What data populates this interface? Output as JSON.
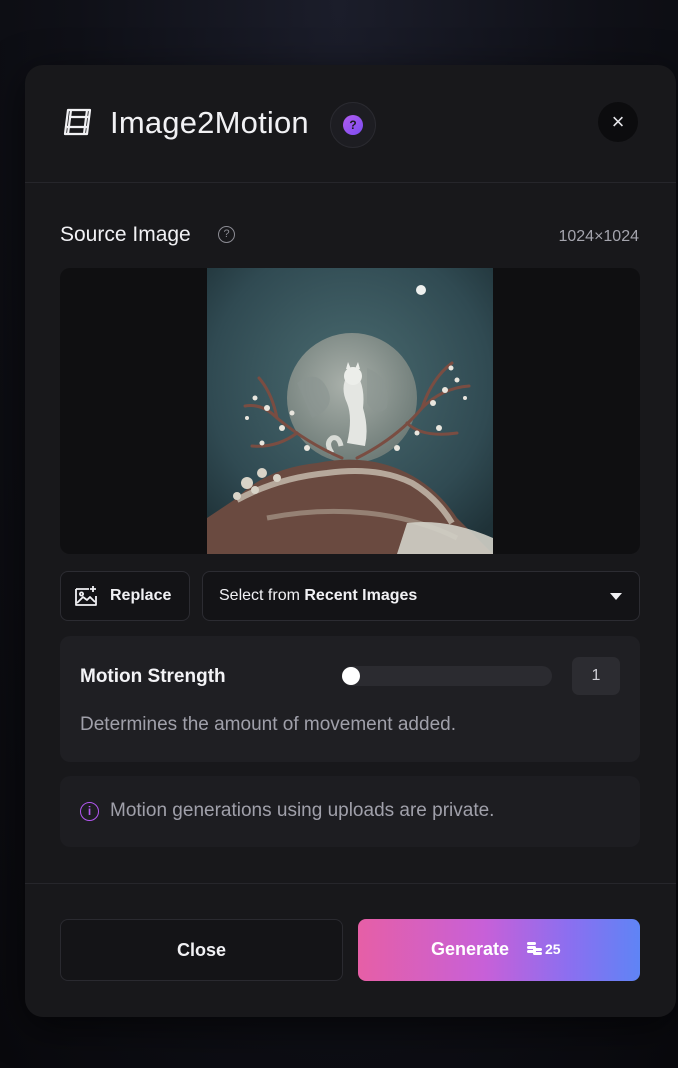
{
  "dialog": {
    "title": "Image2Motion",
    "help_badge_text": "?",
    "close_icon": "×"
  },
  "source": {
    "label": "Source Image",
    "help_icon_text": "?",
    "dimensions": "1024×1024"
  },
  "replace_button": {
    "label": "Replace",
    "icon": "image-sparkle-icon"
  },
  "recent_select": {
    "prefix": "Select from ",
    "value": "Recent Images"
  },
  "motion_strength": {
    "label": "Motion Strength",
    "value": "1",
    "level_fraction": 0.0,
    "description": "Determines the amount of movement added."
  },
  "notice": {
    "icon_text": "i",
    "text": "Motion generations using uploads are private."
  },
  "footer": {
    "close_label": "Close",
    "generate_label": "Generate",
    "generate_cost": "25"
  },
  "colors": {
    "accent_purple": "#b256f0",
    "generate_gradient": [
      "#e65fa6",
      "#c760d8",
      "#8b6ff0",
      "#5f84f5"
    ],
    "panel_bg": "#18181b"
  }
}
